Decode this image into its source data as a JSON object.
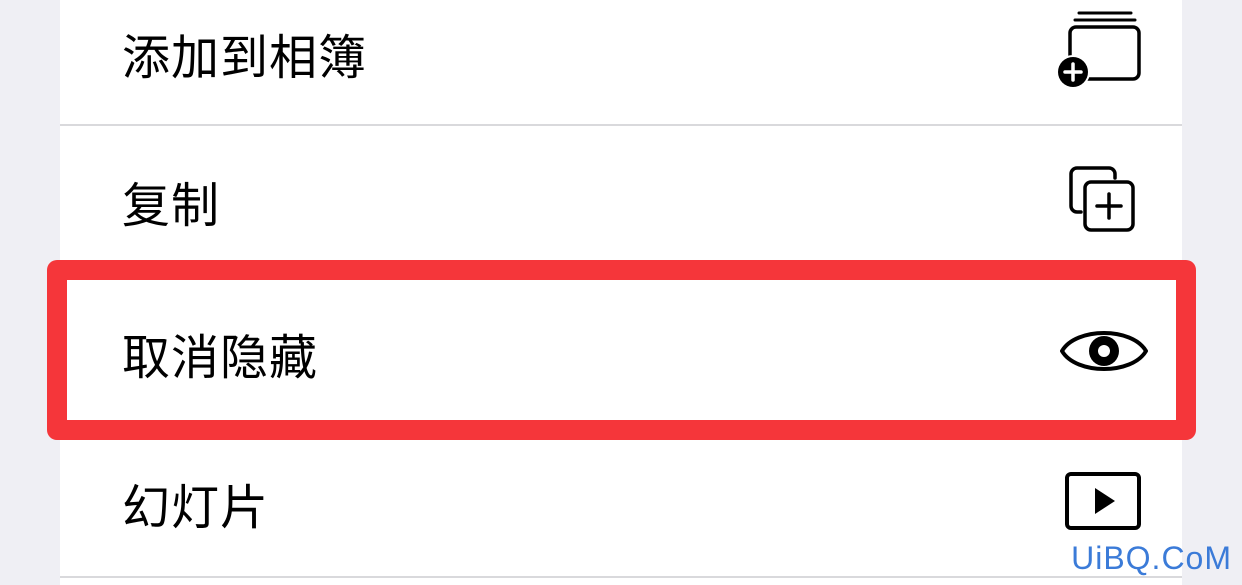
{
  "menu": {
    "items": [
      {
        "label": "添加到相簿",
        "icon": "add-to-album-icon"
      },
      {
        "label": "复制",
        "icon": "duplicate-icon"
      },
      {
        "label": "取消隐藏",
        "icon": "eye-icon"
      },
      {
        "label": "幻灯片",
        "icon": "play-icon"
      }
    ]
  },
  "watermark": {
    "text": "UiBQ.CoM"
  },
  "colors": {
    "highlight": "#f5363a",
    "background": "#efeff4",
    "menu_background": "#ffffff",
    "divider": "#d9d9dc",
    "watermark": "#3b7bd8"
  }
}
